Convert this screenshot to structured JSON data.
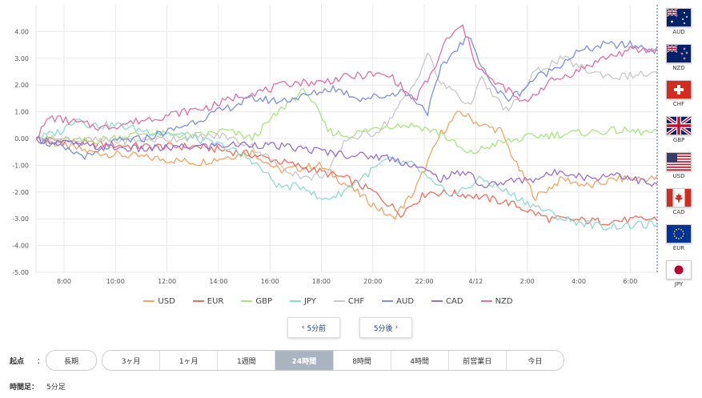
{
  "chart_data": {
    "type": "line",
    "x_ticks": [
      "8:00",
      "10:00",
      "12:00",
      "14:00",
      "16:00",
      "18:00",
      "20:00",
      "22:00",
      "4/12",
      "2:00",
      "4:00",
      "6:00"
    ],
    "y_ticks": [
      "4.00",
      "3.00",
      "2.00",
      "1.00",
      "0.00",
      "-1.00",
      "-2.00",
      "-3.00",
      "-4.00",
      "-5.00"
    ],
    "ylim": [
      -5,
      5
    ],
    "grid": true,
    "legend_position": "bottom",
    "x_sample_interval": "5分足",
    "series": [
      {
        "name": "USD",
        "color": "#f4a460",
        "keyframes": [
          [
            0,
            0
          ],
          [
            20,
            -0.5
          ],
          [
            40,
            -0.7
          ],
          [
            60,
            -0.9
          ],
          [
            80,
            -0.5
          ],
          [
            90,
            -1.2
          ],
          [
            105,
            -1.0
          ],
          [
            120,
            -2.1
          ],
          [
            132,
            -3.0
          ],
          [
            140,
            -2.0
          ],
          [
            150,
            0.2
          ],
          [
            157,
            1.0
          ],
          [
            165,
            0.5
          ],
          [
            172,
            0.3
          ],
          [
            178,
            -1.0
          ],
          [
            185,
            -2.2
          ],
          [
            195,
            -1.5
          ],
          [
            205,
            -1.8
          ],
          [
            215,
            -1.5
          ],
          [
            230,
            -1.5
          ]
        ]
      },
      {
        "name": "EUR",
        "color": "#f46e5a",
        "keyframes": [
          [
            0,
            0
          ],
          [
            20,
            -0.2
          ],
          [
            40,
            -0.3
          ],
          [
            60,
            -0.3
          ],
          [
            80,
            -0.6
          ],
          [
            100,
            -1.1
          ],
          [
            115,
            -1.5
          ],
          [
            125,
            -2.0
          ],
          [
            135,
            -2.8
          ],
          [
            145,
            -2.0
          ],
          [
            160,
            -2.1
          ],
          [
            175,
            -2.4
          ],
          [
            190,
            -3.0
          ],
          [
            210,
            -3.1
          ],
          [
            230,
            -3.0
          ]
        ]
      },
      {
        "name": "GBP",
        "color": "#a6e87a",
        "keyframes": [
          [
            0,
            0
          ],
          [
            20,
            -0.1
          ],
          [
            40,
            0.2
          ],
          [
            60,
            0.1
          ],
          [
            70,
            0.3
          ],
          [
            80,
            0.0
          ],
          [
            90,
            1.0
          ],
          [
            95,
            1.5
          ],
          [
            100,
            1.8
          ],
          [
            108,
            0.3
          ],
          [
            115,
            0.1
          ],
          [
            130,
            0.5
          ],
          [
            140,
            0.5
          ],
          [
            150,
            0.2
          ],
          [
            160,
            -0.6
          ],
          [
            170,
            -0.2
          ],
          [
            185,
            0.1
          ],
          [
            200,
            0.2
          ],
          [
            215,
            0.3
          ],
          [
            230,
            0.2
          ]
        ]
      },
      {
        "name": "JPY",
        "color": "#8cdcd0",
        "keyframes": [
          [
            0,
            0
          ],
          [
            10,
            0.3
          ],
          [
            15,
            0.8
          ],
          [
            20,
            0.5
          ],
          [
            30,
            0.5
          ],
          [
            40,
            0.3
          ],
          [
            55,
            0.1
          ],
          [
            70,
            -0.3
          ],
          [
            80,
            -0.8
          ],
          [
            90,
            -1.8
          ],
          [
            100,
            -1.8
          ],
          [
            105,
            -2.3
          ],
          [
            112,
            -2.1
          ],
          [
            120,
            -1.5
          ],
          [
            130,
            -0.8
          ],
          [
            140,
            -1.0
          ],
          [
            148,
            -1.8
          ],
          [
            155,
            -2.1
          ],
          [
            165,
            -1.5
          ],
          [
            180,
            -2.3
          ],
          [
            195,
            -3.0
          ],
          [
            210,
            -3.3
          ],
          [
            230,
            -3.2
          ]
        ]
      },
      {
        "name": "CHF",
        "color": "#c8c8c8",
        "keyframes": [
          [
            0,
            0
          ],
          [
            30,
            -0.1
          ],
          [
            50,
            0.0
          ],
          [
            70,
            0.1
          ],
          [
            80,
            -0.3
          ],
          [
            90,
            -1.0
          ],
          [
            100,
            -1.5
          ],
          [
            108,
            -1.3
          ],
          [
            115,
            0.0
          ],
          [
            125,
            0.2
          ],
          [
            130,
            0.6
          ],
          [
            140,
            2.0
          ],
          [
            145,
            3.2
          ],
          [
            150,
            2.0
          ],
          [
            155,
            1.8
          ],
          [
            160,
            1.2
          ],
          [
            165,
            2.2
          ],
          [
            170,
            1.5
          ],
          [
            175,
            1.0
          ],
          [
            185,
            2.5
          ],
          [
            195,
            3.0
          ],
          [
            205,
            2.5
          ],
          [
            215,
            2.3
          ],
          [
            225,
            2.4
          ],
          [
            230,
            2.4
          ]
        ]
      },
      {
        "name": "AUD",
        "color": "#7b8fe0",
        "keyframes": [
          [
            0,
            0
          ],
          [
            10,
            -0.4
          ],
          [
            20,
            -0.7
          ],
          [
            30,
            -0.1
          ],
          [
            40,
            0.0
          ],
          [
            50,
            0.3
          ],
          [
            60,
            0.7
          ],
          [
            70,
            1.1
          ],
          [
            80,
            1.5
          ],
          [
            90,
            1.4
          ],
          [
            100,
            1.6
          ],
          [
            110,
            1.9
          ],
          [
            120,
            1.5
          ],
          [
            130,
            1.6
          ],
          [
            135,
            1.8
          ],
          [
            140,
            1.5
          ],
          [
            145,
            1.0
          ],
          [
            150,
            2.6
          ],
          [
            155,
            3.3
          ],
          [
            160,
            3.8
          ],
          [
            165,
            2.8
          ],
          [
            170,
            1.8
          ],
          [
            175,
            1.5
          ],
          [
            180,
            1.8
          ],
          [
            185,
            2.3
          ],
          [
            190,
            2.5
          ],
          [
            200,
            3.2
          ],
          [
            210,
            3.5
          ],
          [
            220,
            3.5
          ],
          [
            230,
            3.3
          ]
        ]
      },
      {
        "name": "CAD",
        "color": "#9a6dd8",
        "keyframes": [
          [
            0,
            0
          ],
          [
            20,
            -0.3
          ],
          [
            40,
            -0.4
          ],
          [
            60,
            -0.3
          ],
          [
            80,
            -0.2
          ],
          [
            100,
            -0.4
          ],
          [
            115,
            -0.6
          ],
          [
            130,
            -0.7
          ],
          [
            140,
            -1.0
          ],
          [
            150,
            -1.5
          ],
          [
            160,
            -1.2
          ],
          [
            165,
            -1.8
          ],
          [
            175,
            -1.6
          ],
          [
            185,
            -1.5
          ],
          [
            195,
            -1.2
          ],
          [
            205,
            -1.5
          ],
          [
            215,
            -1.3
          ],
          [
            230,
            -1.8
          ]
        ]
      },
      {
        "name": "NZD",
        "color": "#e46ea6",
        "keyframes": [
          [
            0,
            0
          ],
          [
            5,
            0.8
          ],
          [
            15,
            0.6
          ],
          [
            25,
            0.4
          ],
          [
            35,
            0.6
          ],
          [
            50,
            0.9
          ],
          [
            65,
            1.2
          ],
          [
            75,
            1.6
          ],
          [
            85,
            1.8
          ],
          [
            95,
            2.1
          ],
          [
            105,
            2.1
          ],
          [
            115,
            2.3
          ],
          [
            125,
            2.4
          ],
          [
            132,
            2.3
          ],
          [
            140,
            1.4
          ],
          [
            147,
            2.5
          ],
          [
            152,
            3.7
          ],
          [
            158,
            4.2
          ],
          [
            163,
            2.8
          ],
          [
            168,
            2.2
          ],
          [
            175,
            1.8
          ],
          [
            180,
            1.3
          ],
          [
            190,
            2.1
          ],
          [
            200,
            2.5
          ],
          [
            210,
            3.0
          ],
          [
            220,
            3.3
          ],
          [
            230,
            3.3
          ]
        ]
      }
    ]
  },
  "nav": {
    "prev_label": "5分前",
    "next_label": "5分後"
  },
  "range": {
    "label": "起点",
    "separator": "：",
    "long_label": "長期",
    "options": [
      "3ヶ月",
      "1ヶ月",
      "1週間",
      "24時間",
      "8時間",
      "4時間",
      "前営業日",
      "今日"
    ],
    "active_index": 3
  },
  "timeframe": {
    "label": "時間足",
    "separator": "：",
    "value": "5分足"
  },
  "flags": [
    {
      "code": "AUD",
      "icon": "flag-au"
    },
    {
      "code": "NZD",
      "icon": "flag-nz"
    },
    {
      "code": "CHF",
      "icon": "flag-ch"
    },
    {
      "code": "GBP",
      "icon": "flag-gb"
    },
    {
      "code": "USD",
      "icon": "flag-us"
    },
    {
      "code": "CAD",
      "icon": "flag-ca"
    },
    {
      "code": "EUR",
      "icon": "flag-eu"
    },
    {
      "code": "JPY",
      "icon": "flag-jp"
    }
  ]
}
